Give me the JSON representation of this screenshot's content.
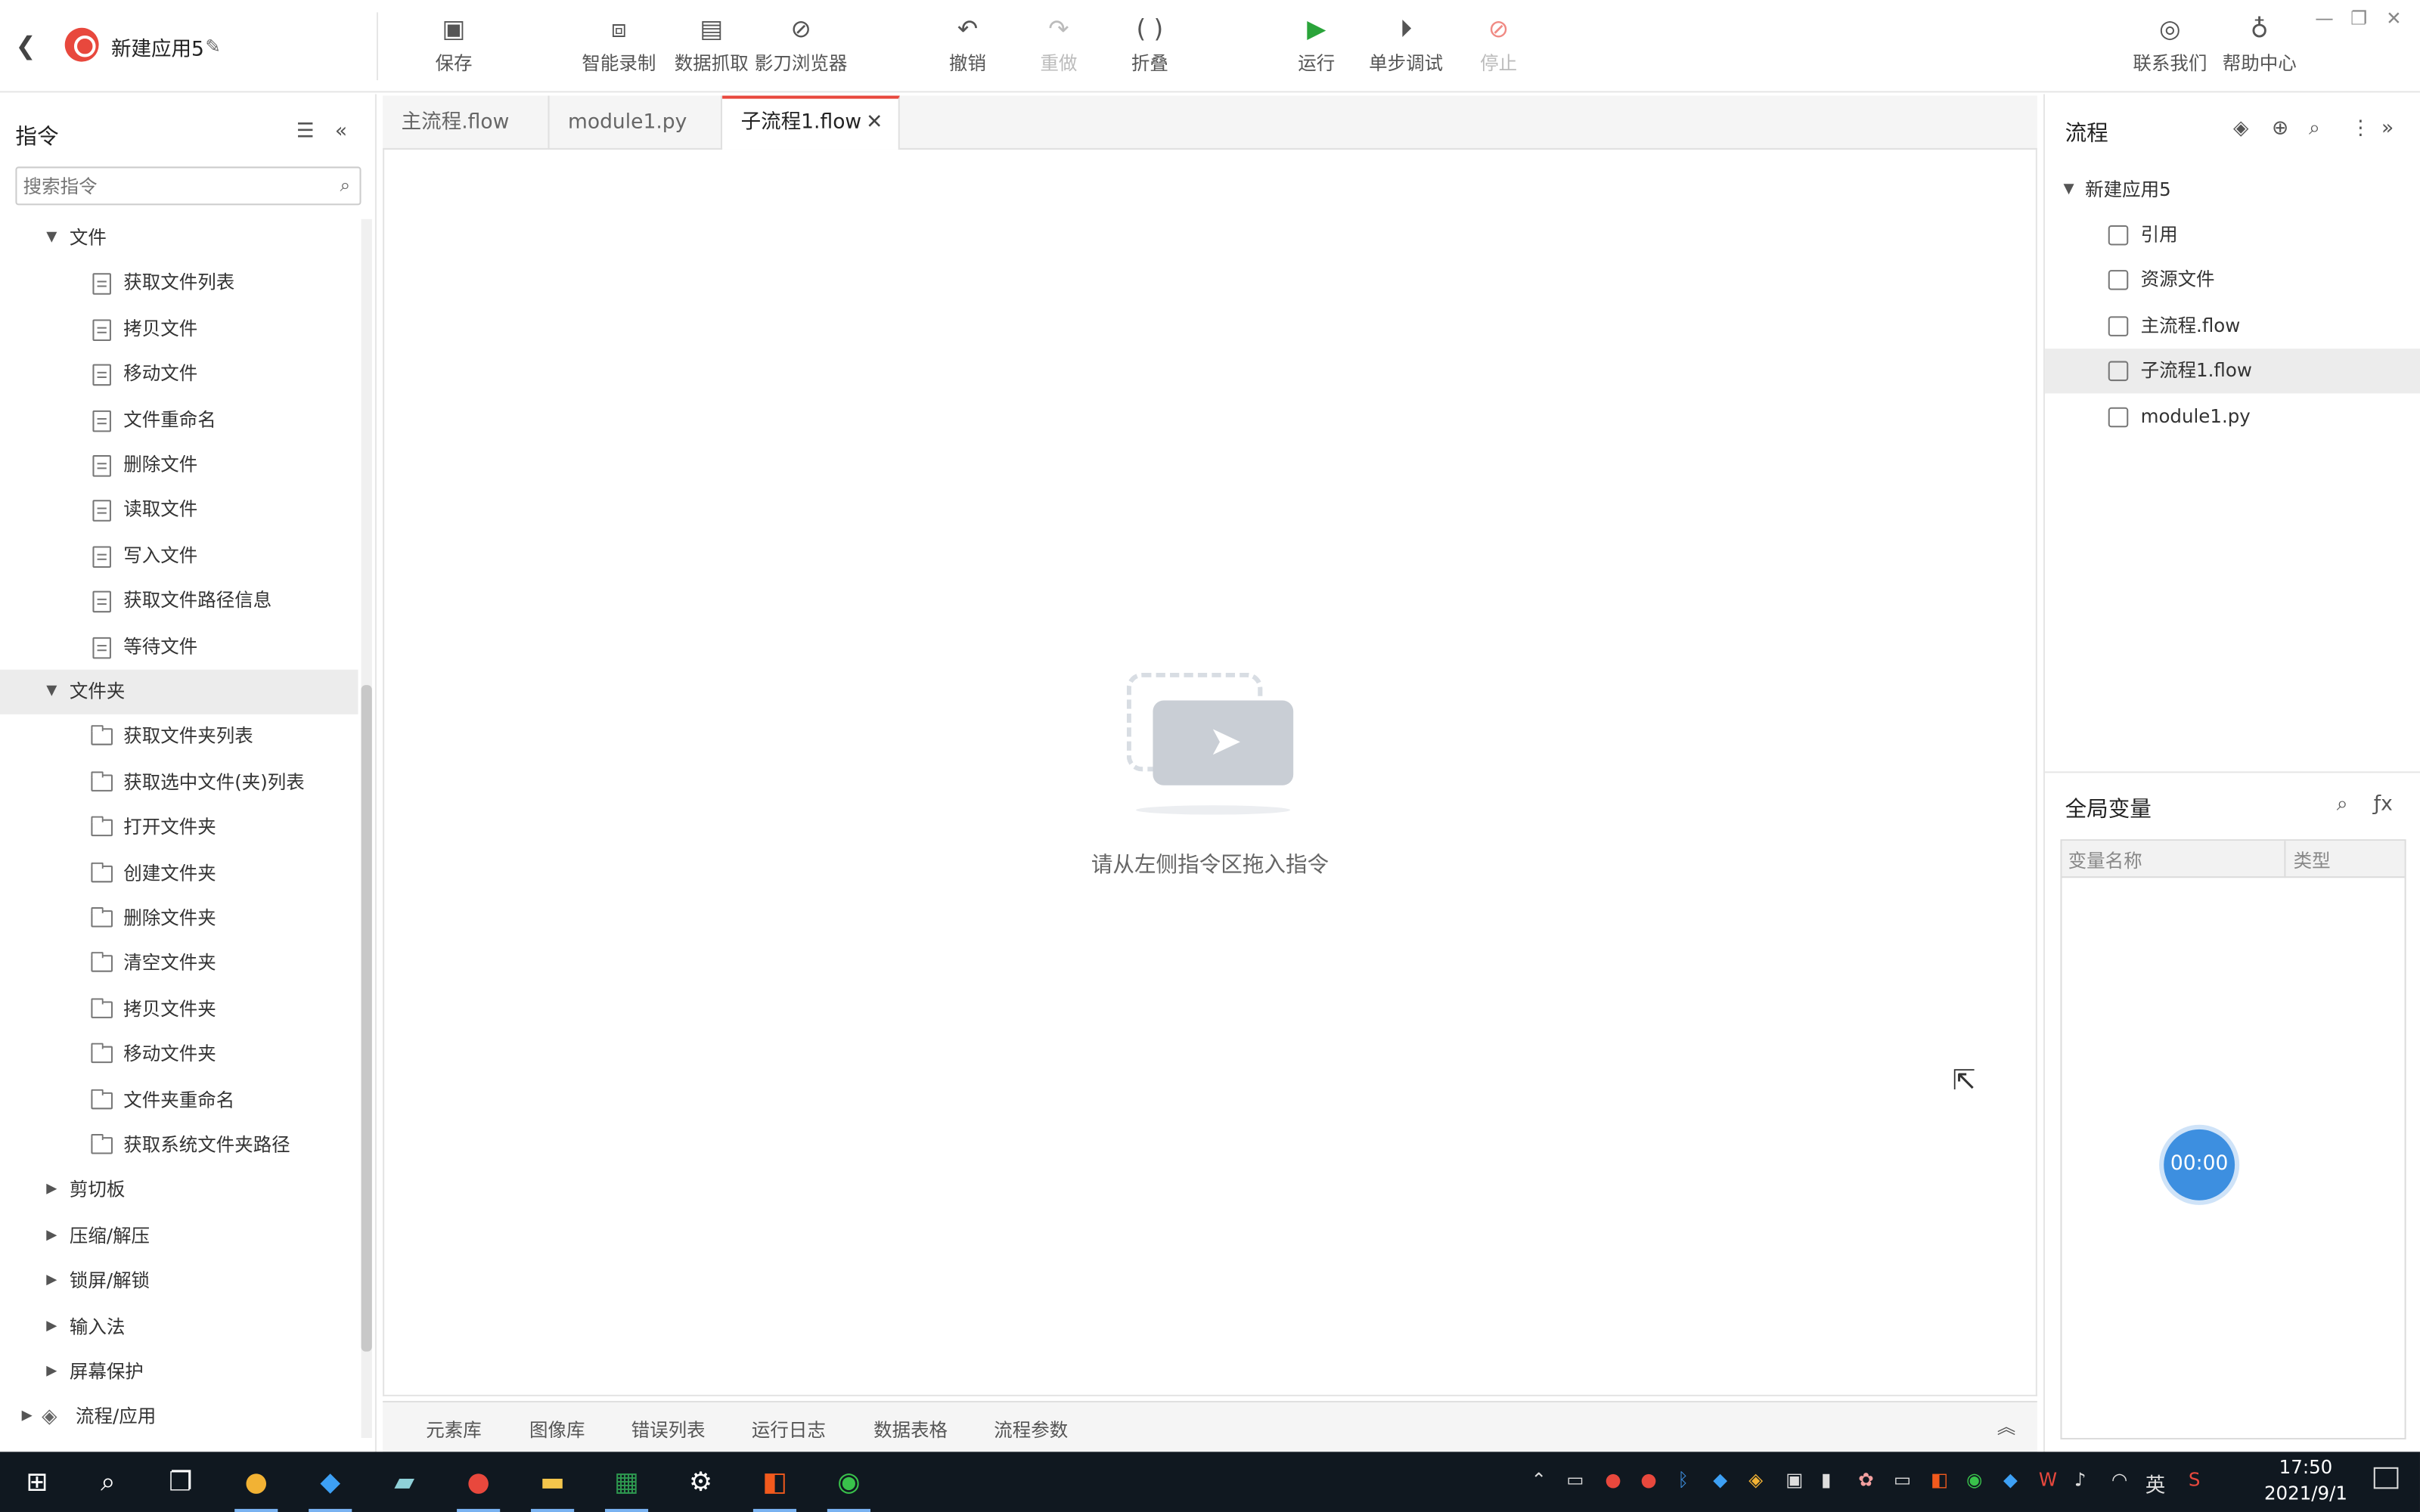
{
  "app": {
    "title": "新建应用5"
  },
  "toolbar": {
    "save": "保存",
    "smart_record": "智能录制",
    "data_scrape": "数据抓取",
    "browser": "影刀浏览器",
    "undo": "撤销",
    "redo": "重做",
    "fold": "折叠",
    "run": "运行",
    "step_debug": "单步调试",
    "stop": "停止",
    "contact": "联系我们",
    "help": "帮助中心"
  },
  "left_panel": {
    "title": "指令",
    "search_placeholder": "搜索指令",
    "file_group": "文件",
    "file_items": [
      "获取文件列表",
      "拷贝文件",
      "移动文件",
      "文件重命名",
      "删除文件",
      "读取文件",
      "写入文件",
      "获取文件路径信息",
      "等待文件"
    ],
    "folder_group": "文件夹",
    "folder_items": [
      "获取文件夹列表",
      "获取选中文件(夹)列表",
      "打开文件夹",
      "创建文件夹",
      "删除文件夹",
      "清空文件夹",
      "拷贝文件夹",
      "移动文件夹",
      "文件夹重命名",
      "获取系统文件夹路径"
    ],
    "other_groups": [
      "剪切板",
      "压缩/解压",
      "锁屏/解锁",
      "输入法",
      "屏幕保护"
    ],
    "flow_group": "流程/应用"
  },
  "tabs": [
    {
      "label": "主流程.flow"
    },
    {
      "label": "module1.py"
    },
    {
      "label": "子流程1.flow"
    }
  ],
  "canvas": {
    "hint": "请从左侧指令区拖入指令"
  },
  "bottom_tabs": [
    "元素库",
    "图像库",
    "错误列表",
    "运行日志",
    "数据表格",
    "流程参数"
  ],
  "right_panel": {
    "title": "流程",
    "root": "新建应用5",
    "items": [
      "引用",
      "资源文件",
      "主流程.flow",
      "子流程1.flow",
      "module1.py"
    ],
    "global_vars_title": "全局变量",
    "col_name": "变量名称",
    "col_type": "类型"
  },
  "timer": "00:00",
  "taskbar": {
    "ime": "英",
    "time": "17:50",
    "date": "2021/9/1"
  },
  "colors": {
    "accent": "#e8483d",
    "run": "#2aa43a",
    "stop": "#f08a84",
    "timer": "#3d8fe0"
  }
}
